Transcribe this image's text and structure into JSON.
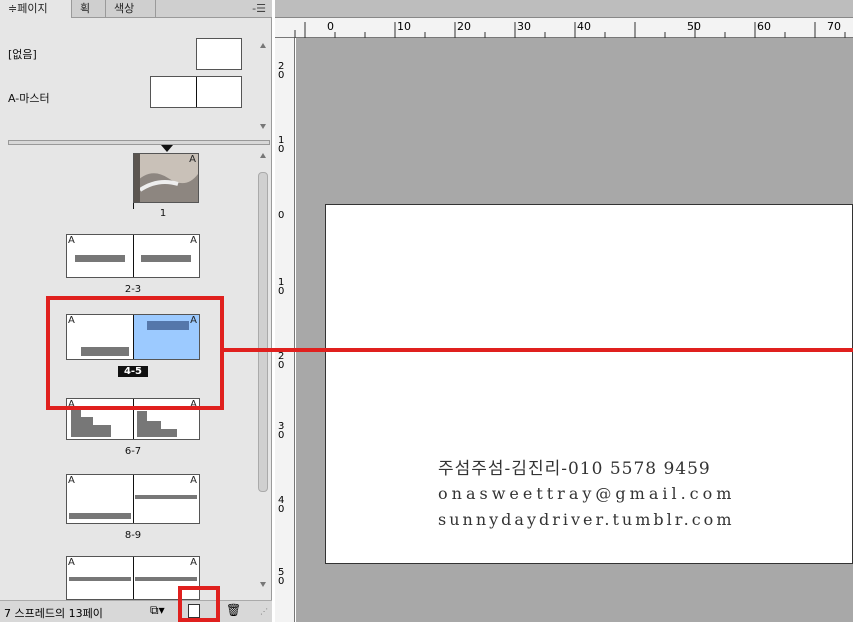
{
  "pages_panel": {
    "tabs": [
      {
        "label": "≑페이지"
      },
      {
        "label": "획"
      },
      {
        "label": "색상"
      }
    ],
    "menu_icon": "panel-menu-icon",
    "masters": [
      {
        "label": "[없음]"
      },
      {
        "label": "A-마스터"
      }
    ],
    "spreads": [
      {
        "label": "1"
      },
      {
        "label": "2-3"
      },
      {
        "label": "4-5"
      },
      {
        "label": "6-7"
      },
      {
        "label": "8-9"
      }
    ],
    "master_prefix": "A",
    "status_text": "7 스프레드의 13페이",
    "highlight_color": "#9ccaff",
    "accent_red": "#e0201e"
  },
  "ruler": {
    "top_ticks": [
      "0",
      "10",
      "20",
      "30",
      "40",
      "50",
      "60",
      "70"
    ],
    "left_ticks": [
      "2 0",
      "1 0",
      "0",
      "1 0",
      "2 0",
      "3 0",
      "4 0",
      "5 0"
    ]
  },
  "document": {
    "card_lines": [
      "주섬주섬-김진리-010 5578 9459",
      "onasweettray@gmail.com",
      "sunnydaydriver.tumblr.com"
    ]
  }
}
